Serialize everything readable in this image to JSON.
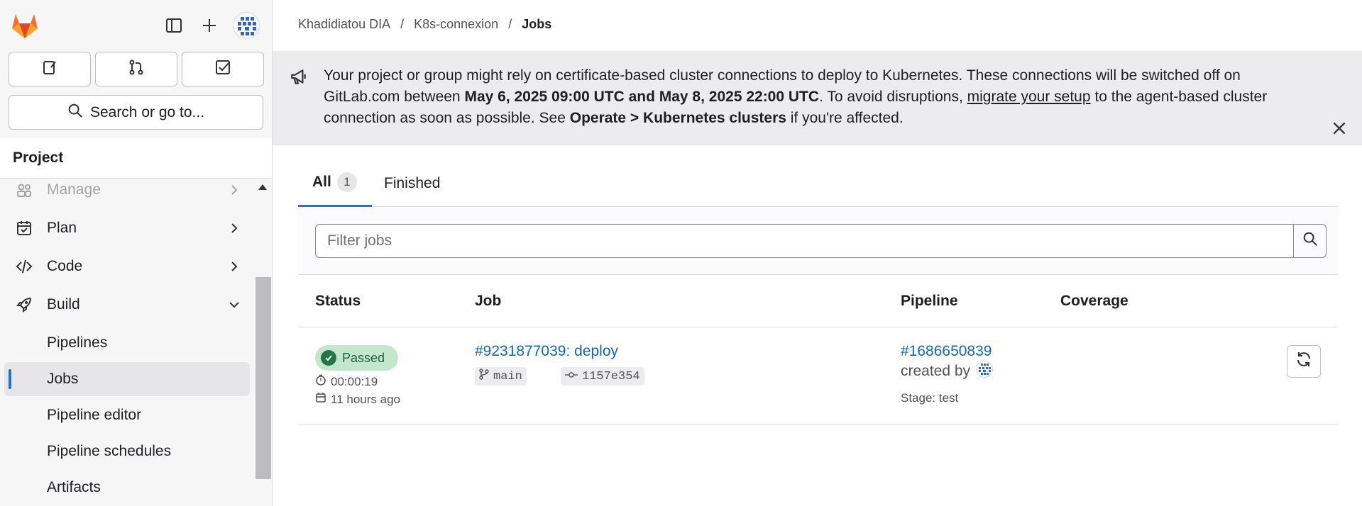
{
  "sidebar": {
    "top_icons": {
      "logo": "gitlab-logo",
      "toggle": "sidebar-toggle-icon",
      "create": "plus-icon",
      "avatar": "user-avatar"
    },
    "quick_buttons": [
      "issues-icon",
      "merge-requests-icon",
      "todos-icon"
    ],
    "search_label": "Search or go to...",
    "section_title": "Project",
    "items": [
      {
        "label": "Manage",
        "icon": "users-icon",
        "chevron": "right"
      },
      {
        "label": "Plan",
        "icon": "planning-icon",
        "chevron": "right"
      },
      {
        "label": "Code",
        "icon": "code-icon",
        "chevron": "right"
      },
      {
        "label": "Build",
        "icon": "rocket-icon",
        "chevron": "down"
      },
      {
        "label": "Pipelines"
      },
      {
        "label": "Jobs",
        "active": true
      },
      {
        "label": "Pipeline editor"
      },
      {
        "label": "Pipeline schedules"
      },
      {
        "label": "Artifacts"
      }
    ]
  },
  "breadcrumb": {
    "items": [
      "Khadidiatou DIA",
      "K8s-connexion",
      "Jobs"
    ],
    "separator": "/"
  },
  "alert": {
    "text_1": "Your project or group might rely on certificate-based cluster connections to deploy to Kubernetes. These connections will be switched off on GitLab.com between ",
    "bold_1": "May 6, 2025 09:00 UTC and May 8, 2025 22:00 UTC",
    "text_2": ". To avoid disruptions, ",
    "link": "migrate your setup",
    "text_3": " to the agent-based cluster connection as soon as possible. See ",
    "bold_2": "Operate > Kubernetes clusters",
    "text_4": " if you're affected."
  },
  "tabs": [
    {
      "label": "All",
      "count": "1",
      "active": true
    },
    {
      "label": "Finished"
    }
  ],
  "filter": {
    "placeholder": "Filter jobs"
  },
  "table": {
    "headers": {
      "status": "Status",
      "job": "Job",
      "pipeline": "Pipeline",
      "coverage": "Coverage"
    },
    "rows": [
      {
        "status": "Passed",
        "duration": "00:00:19",
        "finished": "11 hours ago",
        "job_link": "#9231877039: deploy",
        "branch": "main",
        "commit": "1157e354",
        "pipeline_link": "#1686650839",
        "created_by": "created by",
        "stage": "Stage: test"
      }
    ]
  },
  "colors": {
    "accent": "#1f75cb",
    "link": "#1068bf",
    "success_bg": "#c3e6cd",
    "success": "#217645",
    "gitlab_orange": "#e24329"
  }
}
